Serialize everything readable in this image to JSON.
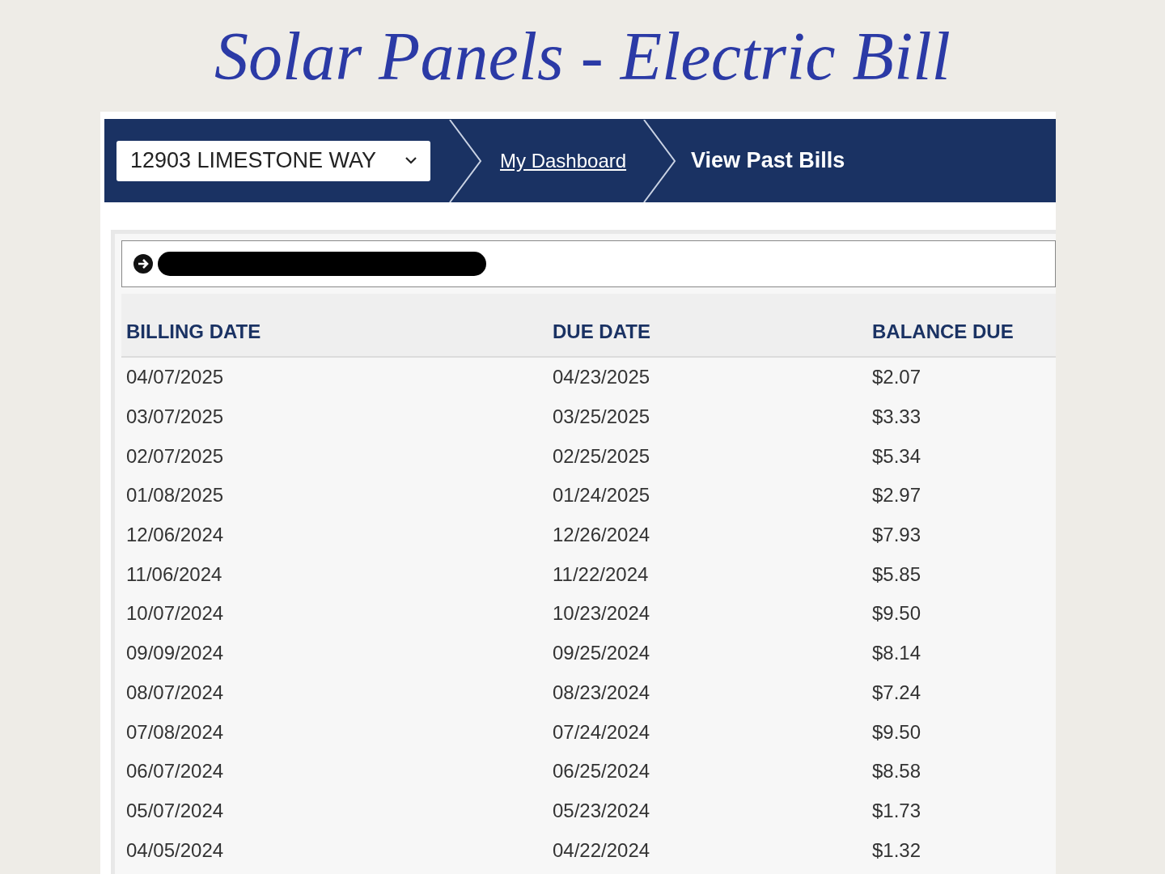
{
  "title": "Solar Panels - Electric Bill",
  "nav": {
    "address_select": "12903 LIMESTONE WAY",
    "breadcrumbs": [
      {
        "label": "My Dashboard",
        "kind": "link"
      },
      {
        "label": "View Past Bills",
        "kind": "current"
      }
    ]
  },
  "table": {
    "columns": [
      "BILLING DATE",
      "DUE DATE",
      "BALANCE DUE"
    ],
    "rows": [
      [
        "04/07/2025",
        "04/23/2025",
        "$2.07"
      ],
      [
        "03/07/2025",
        "03/25/2025",
        "$3.33"
      ],
      [
        "02/07/2025",
        "02/25/2025",
        "$5.34"
      ],
      [
        "01/08/2025",
        "01/24/2025",
        "$2.97"
      ],
      [
        "12/06/2024",
        "12/26/2024",
        "$7.93"
      ],
      [
        "11/06/2024",
        "11/22/2024",
        "$5.85"
      ],
      [
        "10/07/2024",
        "10/23/2024",
        "$9.50"
      ],
      [
        "09/09/2024",
        "09/25/2024",
        "$8.14"
      ],
      [
        "08/07/2024",
        "08/23/2024",
        "$7.24"
      ],
      [
        "07/08/2024",
        "07/24/2024",
        "$9.50"
      ],
      [
        "06/07/2024",
        "06/25/2024",
        "$8.58"
      ],
      [
        "05/07/2024",
        "05/23/2024",
        "$1.73"
      ],
      [
        "04/05/2024",
        "04/22/2024",
        "$1.32"
      ]
    ]
  }
}
